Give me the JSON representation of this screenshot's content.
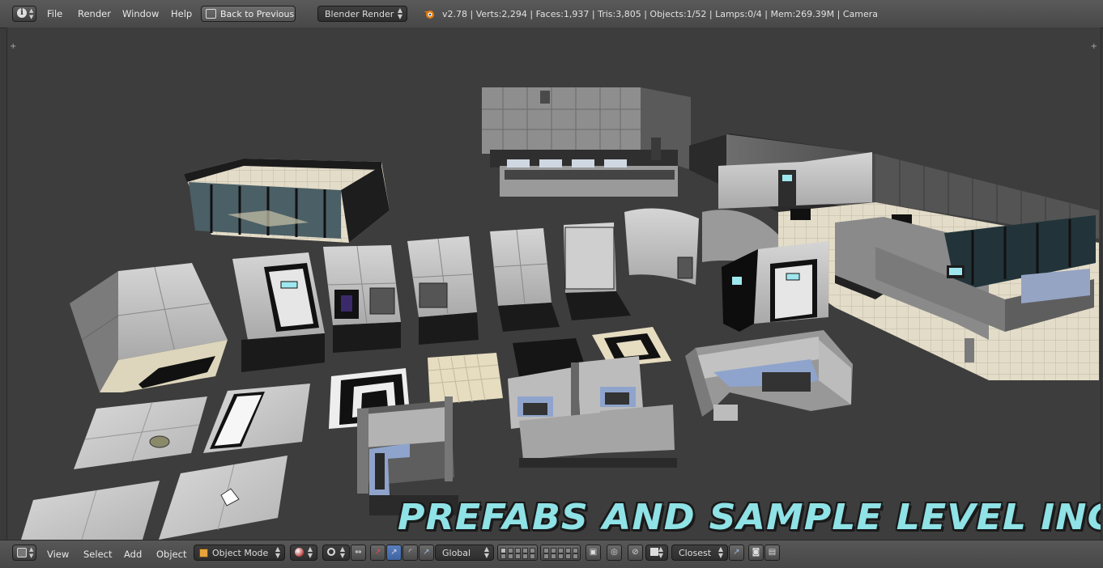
{
  "info_header": {
    "editor_icon": "info-icon",
    "menus": [
      "File",
      "Render",
      "Window",
      "Help"
    ],
    "back_button": "Back to Previous",
    "render_engine": "Blender Render",
    "stats": "v2.78 | Verts:2,294 | Faces:1,937 | Tris:3,805 | Objects:1/52 | Lamps:0/4 | Mem:269.39M | Camera"
  },
  "viewport": {
    "banner_text": "PREFABS AND SAMPLE LEVEL INCLUDED"
  },
  "view3d_header": {
    "editor_icon": "cube-icon",
    "menus": [
      "View",
      "Select",
      "Add",
      "Object"
    ],
    "mode": "Object Mode",
    "pivot_icon": "pivot-icon",
    "orientation": "Global",
    "snap_element": "Closest",
    "icons": [
      "viewport-shading-icon",
      "pivot-point-icon",
      "manipulator-icon",
      "translate-icon",
      "rotate-icon",
      "scale-icon",
      "layers-icon",
      "lock-icon",
      "proportional-edit-icon",
      "snap-magnet-icon",
      "snap-target-icon",
      "render-icon",
      "camera-icon",
      "clapboard-icon"
    ]
  },
  "colors": {
    "header_bg": "#4f4f4f",
    "viewport_bg": "#3d3d3d",
    "banner": "#8fe2e6"
  }
}
